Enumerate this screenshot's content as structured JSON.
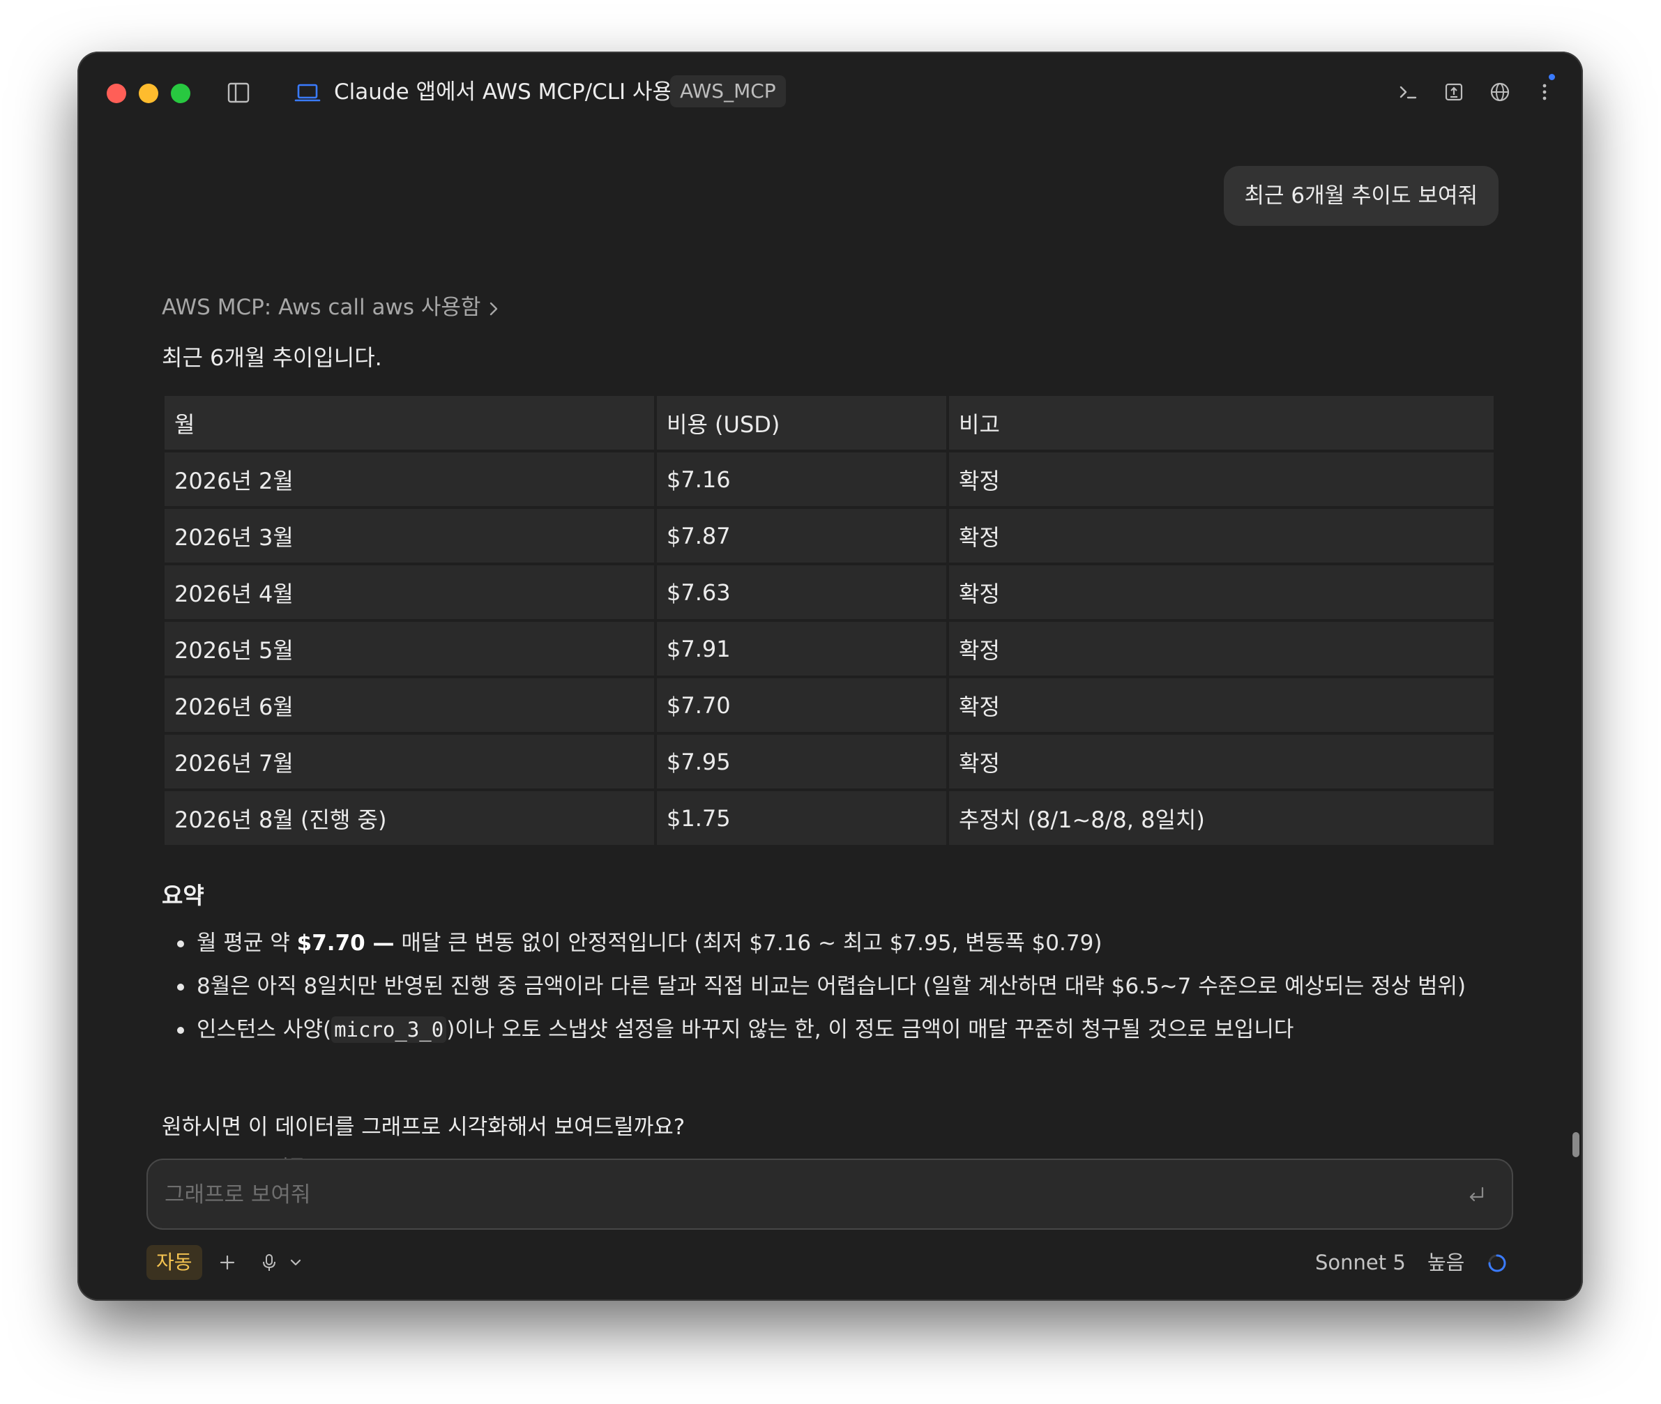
{
  "window": {
    "title": "Claude 앱에서 AWS MCP/CLI 사용",
    "tag": "AWS_MCP"
  },
  "icons": {
    "sidebar": "sidebar-icon",
    "project": "laptop-icon",
    "terminal": "terminal-icon",
    "export": "export-icon",
    "browser": "globe-icon",
    "more": "more-vertical-icon",
    "copy": "copy-icon",
    "pin": "pin-icon",
    "speaker": "speaker-icon",
    "send": "return-icon",
    "add": "plus-icon",
    "mic": "mic-icon",
    "chevron": "chevron-down-icon",
    "spinner": "spinner-icon"
  },
  "colors": {
    "background": "#1f1f1f",
    "accent": "#3a7bff",
    "mode_chip": "#f5c451"
  },
  "conversation": {
    "user_message": "최근 6개월 추이도 보여줘",
    "tool_call": "AWS MCP: Aws call aws 사용함",
    "intro": "최근 6개월 추이입니다.",
    "table": {
      "headers": [
        "월",
        "비용 (USD)",
        "비고"
      ],
      "rows": [
        [
          "2026년 2월",
          "$7.16",
          "확정"
        ],
        [
          "2026년 3월",
          "$7.87",
          "확정"
        ],
        [
          "2026년 4월",
          "$7.63",
          "확정"
        ],
        [
          "2026년 5월",
          "$7.91",
          "확정"
        ],
        [
          "2026년 6월",
          "$7.70",
          "확정"
        ],
        [
          "2026년 7월",
          "$7.95",
          "확정"
        ],
        [
          "2026년 8월 (진행 중)",
          "$1.75",
          "추정치 (8/1~8/8, 8일치)"
        ]
      ]
    },
    "summary_heading": "요약",
    "bullets": [
      {
        "pre": "월 평균 약 ",
        "bold": "$7.70 —",
        "post": " 매달 큰 변동 없이 안정적입니다 (최저 $7.16 ~ 최고 $7.95, 변동폭 $0.79)"
      },
      {
        "text": "8월은 아직 8일치만 반영된 진행 중 금액이라 다른 달과 직접 비교는 어렵습니다 (일할 계산하면 대략 $6.5~7 수준으로 예상되는 정상 범위)"
      },
      {
        "pre": "인스턴스 사양(",
        "code": "micro_3_0",
        "post": ")이나 오토 스냅샷 설정을 바꾸지 않는 한, 이 정도 금액이 매달 꾸준히 청구될 것으로 보입니다"
      }
    ],
    "closing": "원하시면 이 데이터를 그래프로 시각화해서 보여드릴까요?",
    "timestamp": "지금"
  },
  "composer": {
    "placeholder": "그래프로 보여줘"
  },
  "bottom": {
    "mode": "자동",
    "model": "Sonnet 5",
    "effort": "높음"
  }
}
